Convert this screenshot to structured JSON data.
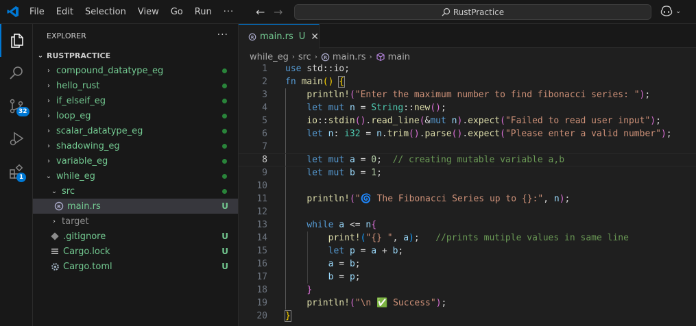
{
  "titlebar": {
    "menu": [
      "File",
      "Edit",
      "Selection",
      "View",
      "Go",
      "Run"
    ],
    "more": "···",
    "search_text": "RustPractice"
  },
  "activity": {
    "source_control_badge": "32",
    "extensions_badge": "1"
  },
  "sidebar": {
    "title": "EXPLORER",
    "more": "···",
    "root": "RUSTPRACTICE",
    "items": [
      {
        "label": "compound_datatype_eg"
      },
      {
        "label": "hello_rust"
      },
      {
        "label": "if_elseif_eg"
      },
      {
        "label": "loop_eg"
      },
      {
        "label": "scalar_datatype_eg"
      },
      {
        "label": "shadowing_eg"
      },
      {
        "label": "variable_eg"
      },
      {
        "label": "while_eg"
      },
      {
        "label": "src"
      },
      {
        "label": "main.rs",
        "status": "U"
      },
      {
        "label": "target"
      },
      {
        "label": ".gitignore",
        "status": "U"
      },
      {
        "label": "Cargo.lock",
        "status": "U"
      },
      {
        "label": "Cargo.toml",
        "status": "U"
      }
    ]
  },
  "editor": {
    "tab_label": "main.rs",
    "tab_status": "U",
    "breadcrumb": [
      "while_eg",
      "src",
      "main.rs",
      "main"
    ],
    "current_line": 8,
    "line_numbers": [
      "1",
      "2",
      "3",
      "4",
      "5",
      "6",
      "7",
      "8",
      "9",
      "10",
      "11",
      "12",
      "13",
      "14",
      "15",
      "16",
      "17",
      "18",
      "19",
      "20"
    ],
    "code": {
      "l1_kw": "use",
      "l1_rest": " std::io;",
      "l2_kw": "fn",
      "l2_fn": "main",
      "l3_fn": "println!",
      "l3_str": "\"Enter the maximum number to find fibonacci series: \"",
      "l4_let": "let",
      "l4_mut": "mut",
      "l4_var": "n",
      "l4_type": "String",
      "l4_fn": "new",
      "l5_mod": "io",
      "l5_fn1": "stdin",
      "l5_fn2": "read_line",
      "l5_mut": "mut",
      "l5_var": "n",
      "l5_fn3": "expect",
      "l5_str": "\"Failed to read user input\"",
      "l6_let": "let",
      "l6_var": "n",
      "l6_type": "i32",
      "l6_var2": "n",
      "l6_fn1": "trim",
      "l6_fn2": "parse",
      "l6_fn3": "expect",
      "l6_str": "\"Please enter a valid number\"",
      "l8_let": "let",
      "l8_mut": "mut",
      "l8_var": "a",
      "l8_num": "0",
      "l8_comment": "// creating mutable variable a,b",
      "l9_let": "let",
      "l9_mut": "mut",
      "l9_var": "b",
      "l9_num": "1",
      "l11_fn": "println!",
      "l11_str": "\"🌀 The Fibonacci Series up to {}:\"",
      "l11_var": "n",
      "l13_kw": "while",
      "l13_var1": "a",
      "l13_var2": "n",
      "l14_fn": "print!",
      "l14_str": "\"{} \"",
      "l14_var": "a",
      "l14_comment": "//prints mutiple values in same line",
      "l15_let": "let",
      "l15_var": "p",
      "l15_var2": "a",
      "l15_var3": "b",
      "l16_var": "a",
      "l16_var2": "b",
      "l17_var": "b",
      "l17_var2": "p",
      "l19_fn": "println!",
      "l19_str": "\"\\n ✅ Success\""
    }
  }
}
